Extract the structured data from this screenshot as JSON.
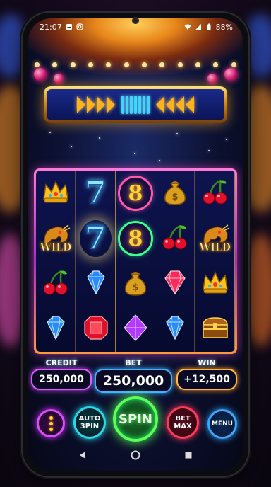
{
  "status_bar": {
    "time": "21:07",
    "battery": "88%"
  },
  "reels": [
    [
      "crown",
      "dragon-wild",
      "cherries",
      "blue-diamond"
    ],
    [
      "seven",
      "seven",
      "blue-diamond",
      "red-gem"
    ],
    [
      "eight",
      "eight-green",
      "money-bag",
      "purple-gem"
    ],
    [
      "money-bag",
      "cherries",
      "red-diamond",
      "blue-diamond"
    ],
    [
      "cherries",
      "dragon-wild",
      "crown",
      "treasure-chest"
    ]
  ],
  "wild_label": "WILD",
  "seven_label": "7",
  "eight_label": "8",
  "hud": {
    "credit_label": "CREDIT",
    "credit_value": "250,000",
    "bet_label": "BET",
    "bet_value": "250,000",
    "win_label": "WIN",
    "win_value": "+12,500"
  },
  "controls": {
    "auto_spin_line1": "AUTO",
    "auto_spin_line2": "3PIN",
    "spin_label": "SPIN",
    "bet_max_line1": "BET",
    "bet_max_line2": "MAX",
    "menu_label": "MENU"
  },
  "colors": {
    "credit": "#e45aff",
    "bet": "#3fb4ff",
    "win": "#ffb84a",
    "spin": "#5aff5a"
  }
}
